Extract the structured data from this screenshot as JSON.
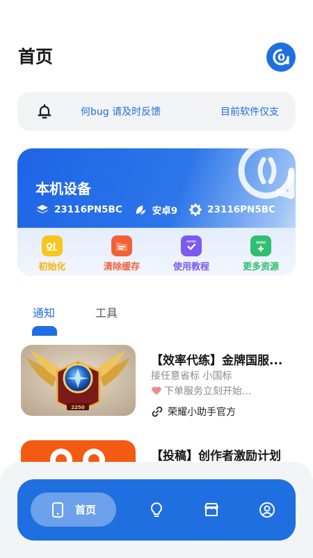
{
  "header": {
    "title": "首页"
  },
  "notice": {
    "text": "何bug 请及时反馈",
    "right": "目前软件仅支"
  },
  "device": {
    "title": "本机设备",
    "model": "23116PN5BC",
    "android": "安卓9",
    "build": "23116PN5BC",
    "actions": [
      {
        "label": "初始化",
        "color": "#f4b400"
      },
      {
        "label": "清除缓存",
        "color": "#f0613a"
      },
      {
        "label": "使用教程",
        "color": "#7a5af0"
      },
      {
        "label": "更多资源",
        "color": "#2fbf71"
      }
    ]
  },
  "tabs": {
    "active": "通知",
    "other": "工具"
  },
  "feed": [
    {
      "title": "【效率代练】金牌国服...",
      "desc1": "接任意省标 小国标",
      "desc2": "下单服务立刻开始...",
      "source": "荣耀小助手官方",
      "badge_text": "2250"
    },
    {
      "title": "【投稿】创作者激励计划"
    }
  ],
  "nav": {
    "home_label": "首页",
    "items": [
      "home-icon",
      "bulb-icon",
      "store-icon",
      "profile-icon"
    ]
  },
  "colors": {
    "primary": "#1f6fe0",
    "notice_bg": "#f2f3f5"
  }
}
